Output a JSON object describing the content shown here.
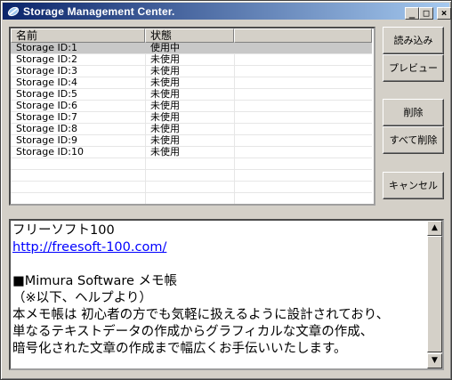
{
  "window": {
    "title": "Storage Management Center.",
    "min": "_",
    "max": "□",
    "close": "×"
  },
  "list": {
    "columns": [
      "名前",
      "状態",
      ""
    ],
    "rows": [
      {
        "name": "Storage ID:1",
        "status": "使用中",
        "selected": true
      },
      {
        "name": "Storage ID:2",
        "status": "未使用"
      },
      {
        "name": "Storage ID:3",
        "status": "未使用"
      },
      {
        "name": "Storage ID:4",
        "status": "未使用"
      },
      {
        "name": "Storage ID:5",
        "status": "未使用"
      },
      {
        "name": "Storage ID:6",
        "status": "未使用"
      },
      {
        "name": "Storage ID:7",
        "status": "未使用"
      },
      {
        "name": "Storage ID:8",
        "status": "未使用"
      },
      {
        "name": "Storage ID:9",
        "status": "未使用"
      },
      {
        "name": "Storage ID:10",
        "status": "未使用"
      }
    ]
  },
  "buttons": {
    "load": "読み込み",
    "preview": "プレビュー",
    "delete": "削除",
    "delete_all": "すべて削除",
    "cancel": "キャンセル"
  },
  "memo": {
    "lines": [
      "フリーソフト100",
      "http://freesoft-100.com/",
      "",
      "■Mimura Software メモ帳",
      "（※以下、ヘルプより）",
      "本メモ帳は 初心者の方でも気軽に扱えるように設計されており、",
      "単なるテキストデータの作成からグラフィカルな文章の作成、",
      "暗号化された文章の作成まで幅広くお手伝いいたします。"
    ]
  },
  "icons": {
    "app": "storage-app-icon",
    "scroll_up": "▲",
    "scroll_down": "▼"
  }
}
